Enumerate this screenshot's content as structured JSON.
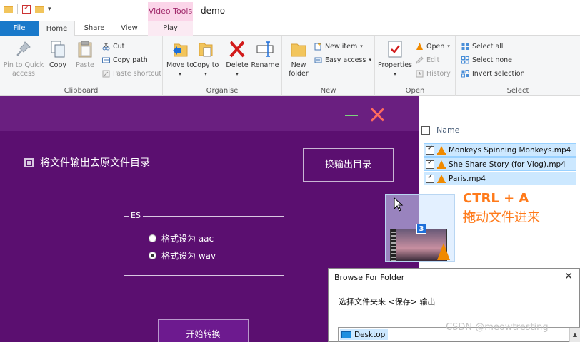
{
  "titlebar": {
    "context_tab_header": "Video Tools",
    "window_title": "demo"
  },
  "tabs": {
    "file": "File",
    "home": "Home",
    "share": "Share",
    "view": "View",
    "play": "Play"
  },
  "ribbon": {
    "clipboard": {
      "label": "Clipboard",
      "pin": "Pin to Quick access",
      "copy": "Copy",
      "paste": "Paste",
      "cut": "Cut",
      "copy_path": "Copy path",
      "paste_shortcut": "Paste shortcut"
    },
    "organise": {
      "label": "Organise",
      "move_to": "Move to",
      "copy_to": "Copy to",
      "delete": "Delete",
      "rename": "Rename"
    },
    "new": {
      "label": "New",
      "new_folder": "New folder",
      "new_item": "New item",
      "easy_access": "Easy access"
    },
    "open": {
      "label": "Open",
      "properties": "Properties",
      "open": "Open",
      "edit": "Edit",
      "history": "History"
    },
    "select": {
      "label": "Select",
      "select_all": "Select all",
      "select_none": "Select none",
      "invert": "Invert selection"
    }
  },
  "filelist": {
    "name_header": "Name",
    "files": [
      {
        "name": "Monkeys Spinning Monkeys.mp4"
      },
      {
        "name": "She Share Story (for Vlog).mp4"
      },
      {
        "name": "Paris.mp4"
      }
    ],
    "drag_count": "3"
  },
  "annotation": {
    "line1": "CTRL + A",
    "line2_bold": "拖",
    "line2_rest": "动文件进来",
    "color": "#ff7a1a"
  },
  "app": {
    "keep_source_dir": "将文件输出去原文件目录",
    "change_output_dir": "换输出目录",
    "es_legend": "ES",
    "radio_aac": "格式设为 aac",
    "radio_wav": "格式设为 wav",
    "selected_format": "wav",
    "start_button": "开始转换",
    "bg_color": "#5b0f70"
  },
  "dialog": {
    "title": "Browse For Folder",
    "instruction": "选择文件夹来 <保存> 输出",
    "tree_item": "Desktop"
  },
  "watermark": "CSDN @meowtresting"
}
